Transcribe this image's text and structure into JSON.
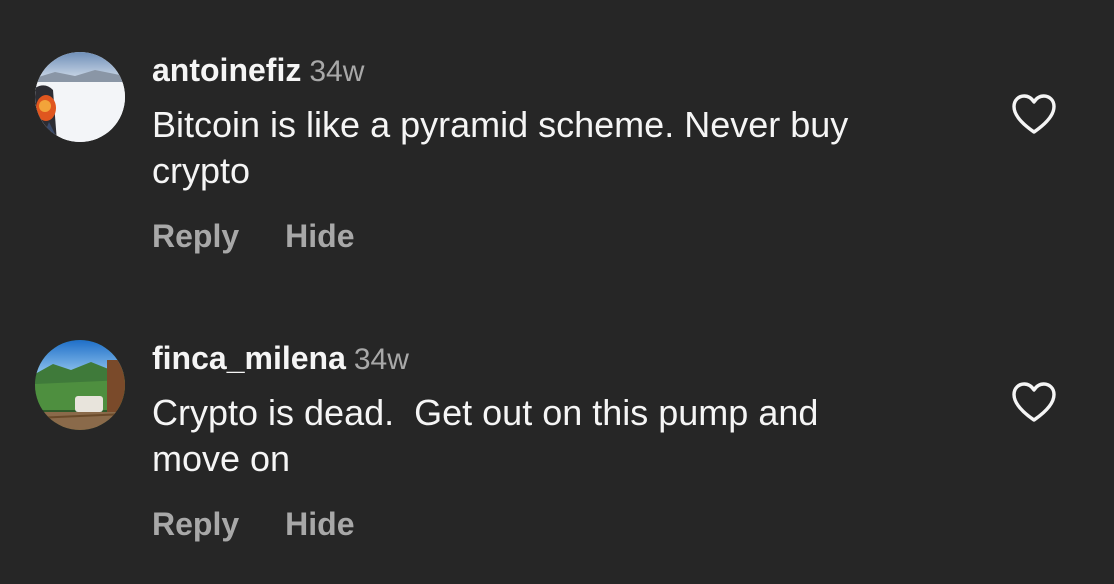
{
  "colors": {
    "background": "#262626",
    "primary_text": "#f5f5f5",
    "secondary_text": "#a8a8a8"
  },
  "comments": [
    {
      "username": "antoinefiz",
      "time": "34w",
      "text": "Bitcoin is like a pyramid scheme. Never buy\ncrypto",
      "reply_label": "Reply",
      "hide_label": "Hide",
      "like_icon": "heart-outline-icon"
    },
    {
      "username": "finca_milena",
      "time": "34w",
      "text": "Crypto is dead.  Get out on this pump and\nmove on",
      "reply_label": "Reply",
      "hide_label": "Hide",
      "like_icon": "heart-outline-icon"
    }
  ]
}
